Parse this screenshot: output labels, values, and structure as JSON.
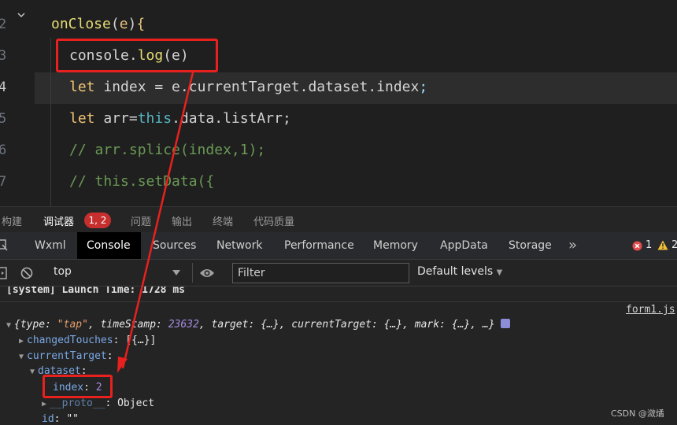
{
  "editor": {
    "line_numbers": [
      "2",
      "3",
      "4",
      "5",
      "6",
      "7"
    ],
    "active_line": "4",
    "lines": [
      {
        "name": "onClose",
        "paren_open": "(",
        "param": "e",
        "paren_close": ")",
        "brace": "{"
      },
      {
        "obj": "console",
        "dot": ".",
        "method": "log",
        "args": "(e)"
      },
      {
        "kw": "let",
        "rest1": " index = e.",
        "p1": "currentTarget",
        "d1": ".",
        "p2": "dataset",
        "d2": ".",
        "p3": "index",
        "end": ";"
      },
      {
        "kw": "let",
        "rest1": " arr=",
        "this": "this",
        "rest2": ".data.listArr;"
      },
      {
        "comment": "// arr.splice(index,1);"
      },
      {
        "comment": "// this.setData({"
      }
    ]
  },
  "panel_tabs": [
    "构建",
    "调试器",
    "问题",
    "输出",
    "终端",
    "代码质量"
  ],
  "panel_badge": "1, 2",
  "devtools_tabs": [
    "Wxml",
    "Console",
    "Sources",
    "Network",
    "Performance",
    "Memory",
    "AppData",
    "Storage"
  ],
  "devtools_more": "»",
  "status": {
    "errors": "1",
    "warnings": "2"
  },
  "toolbar": {
    "context": "top",
    "filter_placeholder": "Filter",
    "levels": "Default levels"
  },
  "console": {
    "launch_line": "[system] Launch Time: 1728 ms",
    "source_link": "form1.js",
    "obj_open": "{",
    "type_key": "type",
    "type_val": "\"tap\"",
    "ts_key": "timeStamp",
    "ts_val": "23632",
    "rest": ", target: {…}, currentTarget: {…}, mark: {…}, …}",
    "changed_key": "changedTouches",
    "changed_val": "[{…}]",
    "current_key": "currentTarget",
    "dataset_key": "dataset",
    "index_key": "index",
    "index_val": "2",
    "proto_key": "__proto__",
    "proto_val": "Object",
    "id_key": "id",
    "id_val": "\"\""
  },
  "watermark": "CSDN @潋燏",
  "colors": {
    "accent_red": "#e8211e",
    "keyword": "#f0c674",
    "comment": "#6a9955"
  }
}
